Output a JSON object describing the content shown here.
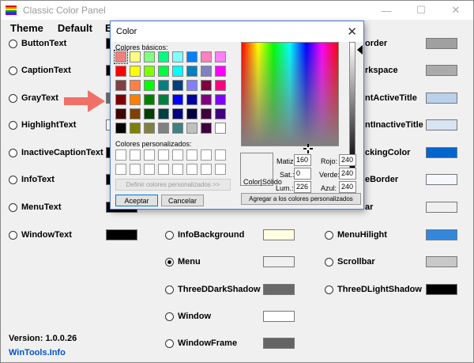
{
  "window": {
    "title": "Classic Color Panel",
    "controls": {
      "minimize": "—",
      "maximize": "☐",
      "close": "✕"
    }
  },
  "menu": [
    "Theme",
    "Default",
    "Exp"
  ],
  "columns": [
    [
      {
        "label": "ButtonText",
        "color": "#000000",
        "checked": false
      },
      {
        "label": "CaptionText",
        "color": "#000000",
        "checked": false
      },
      {
        "label": "GrayText",
        "color": "#6d6d6d",
        "checked": false
      },
      {
        "label": "HighlightText",
        "color": "#ffffff",
        "checked": false
      },
      {
        "label": "InactiveCaptionText",
        "color": "#000000",
        "checked": false
      },
      {
        "label": "InfoText",
        "color": "#000000",
        "checked": false
      },
      {
        "label": "MenuText",
        "color": "#000000",
        "checked": false
      },
      {
        "label": "WindowText",
        "color": "#000000",
        "checked": false
      }
    ],
    [
      {
        "label": "InfoBackground",
        "color": "#ffffe1",
        "checked": false
      },
      {
        "label": "Menu",
        "color": "#f0f0f0",
        "checked": true
      },
      {
        "label": "ThreeDDarkShadow",
        "color": "#696969",
        "checked": false
      },
      {
        "label": "Window",
        "color": "#ffffff",
        "checked": false
      },
      {
        "label": "WindowFrame",
        "color": "#646464",
        "checked": false
      }
    ],
    [
      {
        "label": "order",
        "color": "#a0a0a0"
      },
      {
        "label": "rkspace",
        "color": "#ababab"
      },
      {
        "label": "ntActiveTitle",
        "color": "#b9d1ea"
      },
      {
        "label": "ntInactiveTitle",
        "color": "#d7e4f2"
      },
      {
        "label": "ckingColor",
        "color": "#0066cc"
      },
      {
        "label": "eBorder",
        "color": "#f4f7fc"
      },
      {
        "label": "ar",
        "color": "#f0f0f0"
      },
      {
        "label": "MenuHilight",
        "color": "#3388dd",
        "checked": false
      },
      {
        "label": "Scrollbar",
        "color": "#c8c8c8",
        "checked": false
      },
      {
        "label": "ThreeDLightShadow",
        "color": "#000000",
        "checked": false
      }
    ]
  ],
  "footer": {
    "version": "Version: 1.0.0.26",
    "link": "WinTools.Info"
  },
  "dialog": {
    "title": "Color",
    "basic_label": "Colores básicos:",
    "custom_label": "Colores personalizados:",
    "define_button": "Definir colores personalizados >>",
    "accept_button": "Aceptar",
    "cancel_button": "Cancelar",
    "add_button": "Agregar a los colores personalizados",
    "preview_label": "Color|Sólido",
    "fields": {
      "hue": {
        "label": "Matiz:",
        "value": "160"
      },
      "sat": {
        "label": "Sat.:",
        "value": "0"
      },
      "lum": {
        "label": "Lum.:",
        "value": "226"
      },
      "red": {
        "label": "Rojo:",
        "value": "240"
      },
      "green": {
        "label": "Verde:",
        "value": "240"
      },
      "blue": {
        "label": "Azul:",
        "value": "240"
      }
    },
    "basic_colors": [
      "#f08080",
      "#ffff80",
      "#80ff80",
      "#00ff80",
      "#80ffff",
      "#0080ff",
      "#ff80c0",
      "#ff80ff",
      "#ff0000",
      "#ffff00",
      "#80ff00",
      "#00ff40",
      "#00ffff",
      "#0080c0",
      "#8080c0",
      "#ff00ff",
      "#804040",
      "#ff8040",
      "#00ff00",
      "#008080",
      "#004080",
      "#8080ff",
      "#800040",
      "#ff0080",
      "#800000",
      "#ff8000",
      "#008000",
      "#008040",
      "#0000ff",
      "#0000a0",
      "#800080",
      "#8000ff",
      "#400000",
      "#804000",
      "#004000",
      "#004040",
      "#000080",
      "#000040",
      "#400040",
      "#400080",
      "#000000",
      "#808000",
      "#808040",
      "#808080",
      "#408080",
      "#c0c0c0",
      "#400040",
      "#ffffff"
    ]
  }
}
